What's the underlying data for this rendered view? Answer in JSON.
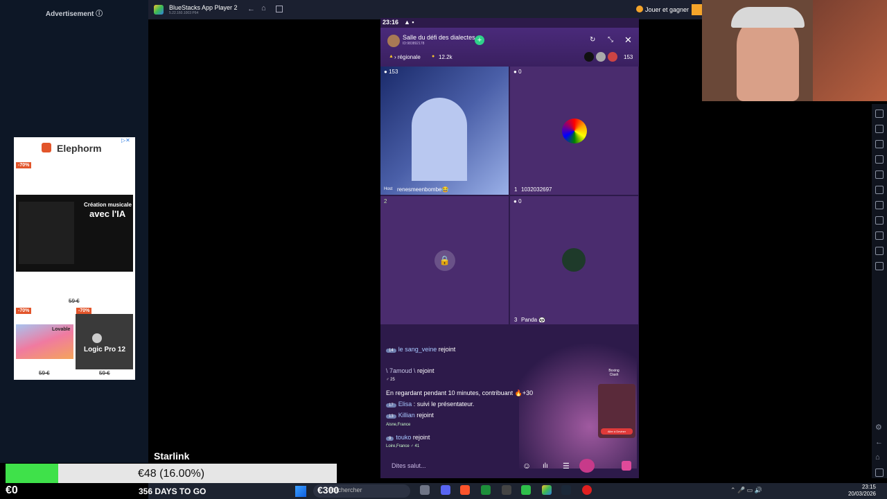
{
  "left_panel": {
    "ad_label": "Advertisement ⓘ",
    "ad": {
      "brand": "Elephorm",
      "discount1": "-70%",
      "promo_line1": "Création musicale",
      "promo_line2": "avec l'IA",
      "price1": "59 €",
      "discount2": "-70%",
      "discount3": "-70%",
      "product2": "Lovable",
      "product3": "Logic Pro 12",
      "price2": "59 €",
      "price3": "59 €"
    }
  },
  "bluestacks": {
    "title": "BlueStacks App Player 2",
    "subtitle": "5.22.160.1003 P64",
    "earn_label": "Jouer et gagner"
  },
  "phone": {
    "time": "23:16",
    "room_title": "Salle du défi des dialectes",
    "room_id": "ID:983892178",
    "region": "› régionale",
    "coins": "12.2k",
    "viewer_count": "153",
    "tiles": [
      {
        "score": "153",
        "host_badge": "Host",
        "name": "renesmeenbombe😂"
      },
      {
        "score": "0",
        "seat": "1",
        "name": "1032032697"
      },
      {
        "seat": "2"
      },
      {
        "score": "0",
        "seat": "3",
        "name": "Panda 🐼"
      }
    ],
    "chat": [
      {
        "level": "14",
        "user": "le sang_veine",
        "text": "rejoint"
      },
      {
        "level": "",
        "user": "\\ 7amoud \\",
        "text": "rejoint",
        "gender_count": "25"
      },
      {
        "system": "En regardant pendant 10 minutes, contribuant 🔥+30"
      },
      {
        "level": "17",
        "user": "Elisa",
        "text": ": suivi le présentateur."
      },
      {
        "level": "13",
        "user": "Killian",
        "text": "rejoint",
        "location": "Aisne,France"
      },
      {
        "level": "9",
        "user": "touko",
        "text": "rejoint",
        "location": "Loire,France",
        "gender_count": "41"
      }
    ],
    "game_title": "Boxing Clash",
    "game_button": "Aller à Deviner",
    "input_placeholder": "Dites salut..."
  },
  "overlay": {
    "starlink": "Starlink",
    "progress_text": "€48 (16.00%)",
    "progress_value": 0.16,
    "start_amount": "€0",
    "days": "356 DAYS TO GO",
    "goal": "€300"
  },
  "taskbar": {
    "search_placeholder": "Rechercher",
    "time": "23:15",
    "date": "20/03/2026"
  },
  "colors": {
    "progress": "#3fe14a",
    "discount": "#e2552b",
    "phone_bg": "#2d1a4a"
  }
}
